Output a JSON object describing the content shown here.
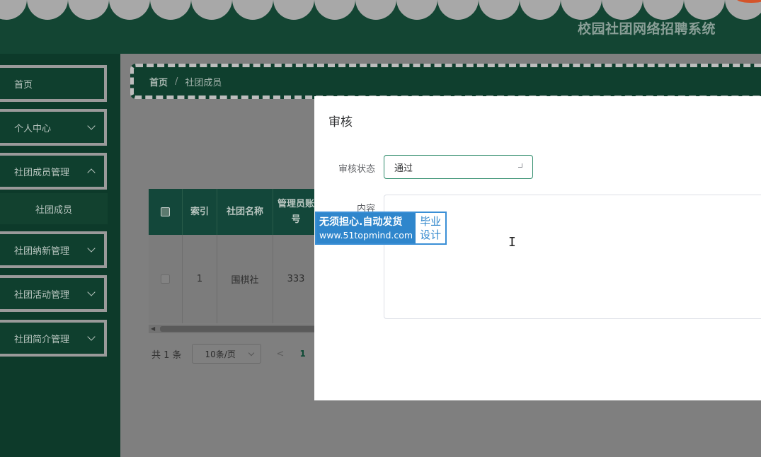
{
  "header": {
    "title": "校园社团网络招聘系统"
  },
  "sidebar": {
    "items": [
      {
        "label": "首页",
        "has_chevron": false
      },
      {
        "label": "个人中心",
        "has_chevron": true
      },
      {
        "label": "社团成员管理",
        "has_chevron": true
      },
      {
        "label": "社团成员",
        "submenu": true
      },
      {
        "label": "社团纳新管理",
        "has_chevron": true
      },
      {
        "label": "社团活动管理",
        "has_chevron": true
      },
      {
        "label": "社团简介管理",
        "has_chevron": true
      }
    ]
  },
  "breadcrumb": {
    "home": "首页",
    "separator": "/",
    "current": "社团成员"
  },
  "table": {
    "columns": [
      "索引",
      "社团名称",
      "管理员账号"
    ],
    "rows": [
      {
        "index": "1",
        "name": "围棋社",
        "account": "333"
      }
    ]
  },
  "pagination": {
    "total": "共 1 条",
    "page_size": "10条/页",
    "prev": "<",
    "current_page": "1"
  },
  "dialog": {
    "title": "审核",
    "status_label": "审核状态",
    "status_value": "通过",
    "content_label": "内容",
    "content_value": ""
  },
  "watermark": {
    "line1": "无须担心.自动发货",
    "line2": "www.51topmind.com",
    "right1": "毕业",
    "right2": "设计"
  },
  "colors": {
    "primary": "#134533",
    "sidebar_bg": "#0d3a2a",
    "overlay": "#7f7f7f",
    "dialog_bg": "#ffffff",
    "select_border": "#2e8b6a",
    "watermark_blue": "#2f86cc"
  }
}
